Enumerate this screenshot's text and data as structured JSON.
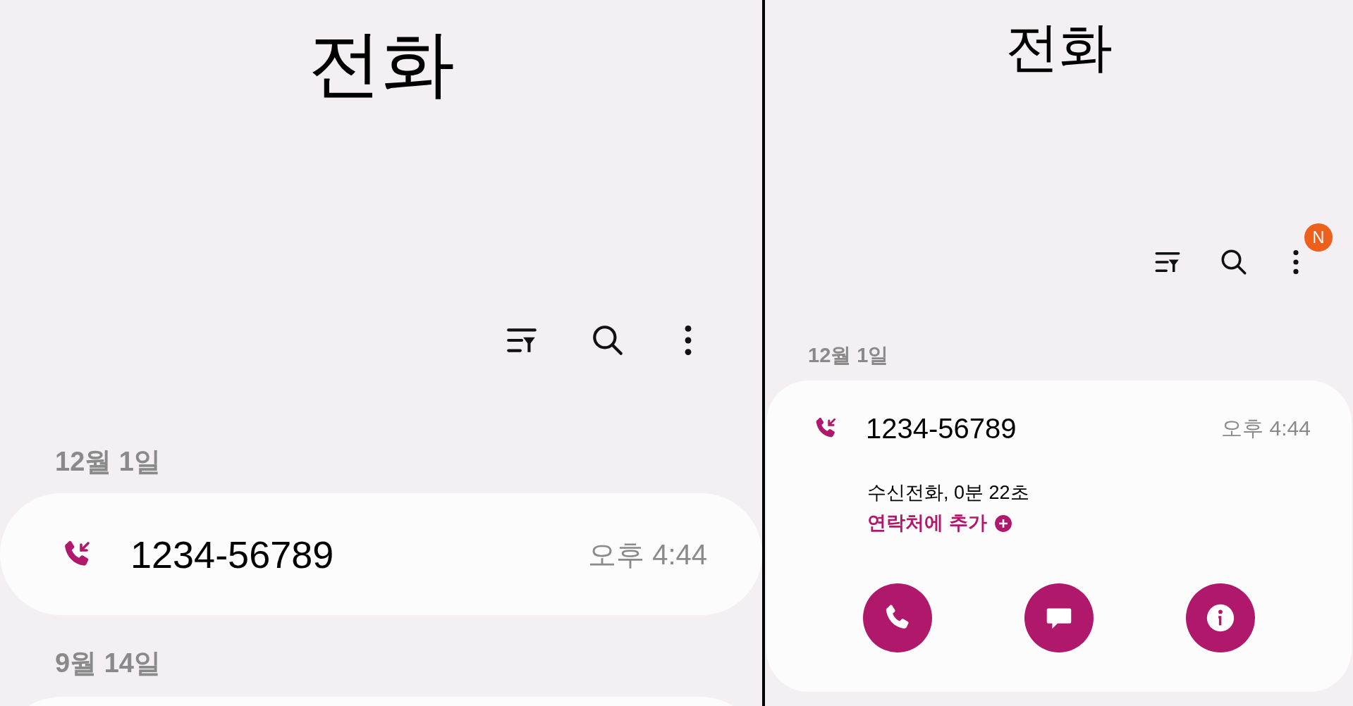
{
  "panels": [
    {
      "title": "전화",
      "groups": [
        {
          "date": "12월 1일",
          "calls": [
            {
              "number": "1234-56789",
              "time": "오후 4:44",
              "expanded": false
            }
          ]
        },
        {
          "date": "9월 14일"
        }
      ]
    },
    {
      "title": "전화",
      "toolbar": {
        "menu_badge": "N"
      },
      "groups": [
        {
          "date": "12월 1일",
          "calls": [
            {
              "number": "1234-56789",
              "time": "오후 4:44",
              "expanded": true,
              "detail": "수신전화, 0분 22초",
              "add_contact": "연락처에 추가"
            }
          ]
        }
      ]
    }
  ]
}
